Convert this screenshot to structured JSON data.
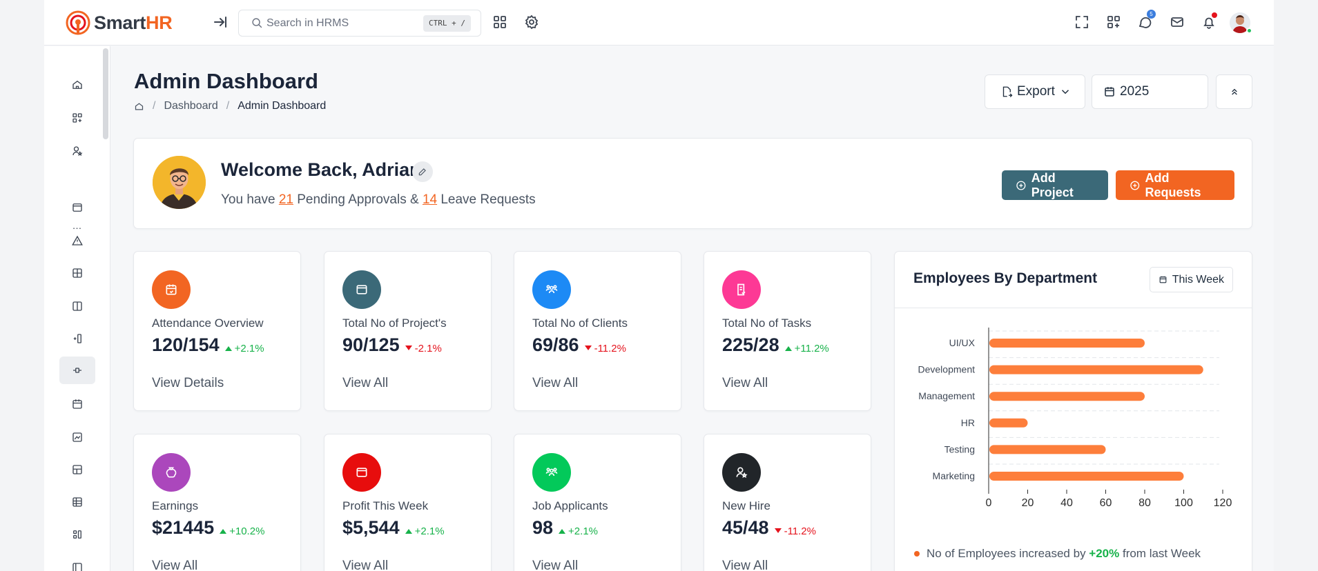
{
  "header": {
    "logo_smart": "Smart",
    "logo_hr": "HR",
    "search_placeholder": "Search in HRMS",
    "search_shortcut": "CTRL + /",
    "chat_badge": "5"
  },
  "page": {
    "title": "Admin Dashboard",
    "breadcrumb": [
      "Dashboard",
      "Admin Dashboard"
    ],
    "export_label": "Export",
    "year_value": "2025"
  },
  "welcome": {
    "title": "Welcome Back, Adrian",
    "sub_prefix": "You have ",
    "pending_count": "21",
    "sub_middle": " Pending Approvals & ",
    "leave_count": "14",
    "sub_suffix": " Leave Requests",
    "add_project": "Add Project",
    "add_requests": "Add Requests"
  },
  "stats": [
    {
      "label": "Attendance Overview",
      "value": "120/154",
      "trend": "+2.1%",
      "direction": "up",
      "link": "View Details",
      "color": "#f26522",
      "icon": "calendar-check-icon"
    },
    {
      "label": "Total No of Project's",
      "value": "90/125",
      "trend": "-2.1%",
      "direction": "down",
      "link": "View All",
      "color": "#3b6978",
      "icon": "browser-icon"
    },
    {
      "label": "Total No of Clients",
      "value": "69/86",
      "trend": "-11.2%",
      "direction": "down",
      "link": "View All",
      "color": "#1d8af5",
      "icon": "users-group-icon"
    },
    {
      "label": "Total No of Tasks",
      "value": "225/28",
      "trend": "+11.2%",
      "direction": "up",
      "link": "View All",
      "color": "#fd3995",
      "icon": "checklist-icon"
    },
    {
      "label": "Earnings",
      "value": "$21445",
      "trend": "+10.2%",
      "direction": "up",
      "link": "View All",
      "color": "#ab47bc",
      "icon": "moneybag-icon"
    },
    {
      "label": "Profit This Week",
      "value": "$5,544",
      "trend": "+2.1%",
      "direction": "up",
      "link": "View All",
      "color": "#e70d0d",
      "icon": "browser-icon"
    },
    {
      "label": "Job Applicants",
      "value": "98",
      "trend": "+2.1%",
      "direction": "up",
      "link": "View All",
      "color": "#03c95a",
      "icon": "users-group-icon"
    },
    {
      "label": "New Hire",
      "value": "45/48",
      "trend": "-11.2%",
      "direction": "down",
      "link": "View All",
      "color": "#212529",
      "icon": "user-star-icon"
    }
  ],
  "department": {
    "title": "Employees By Department",
    "filter": "This Week",
    "footer_prefix": "No of Employees increased by ",
    "footer_pct": "+20%",
    "footer_suffix": " from last Week"
  },
  "chart_data": {
    "type": "bar",
    "orientation": "horizontal",
    "categories": [
      "UI/UX",
      "Development",
      "Management",
      "HR",
      "Testing",
      "Marketing"
    ],
    "values": [
      80,
      110,
      80,
      20,
      60,
      100
    ],
    "x_ticks": [
      "0",
      "20",
      "40",
      "60",
      "80",
      "100",
      "120"
    ],
    "xlim": [
      0,
      120
    ],
    "bar_color": "#fd7e3b",
    "grid": true
  }
}
